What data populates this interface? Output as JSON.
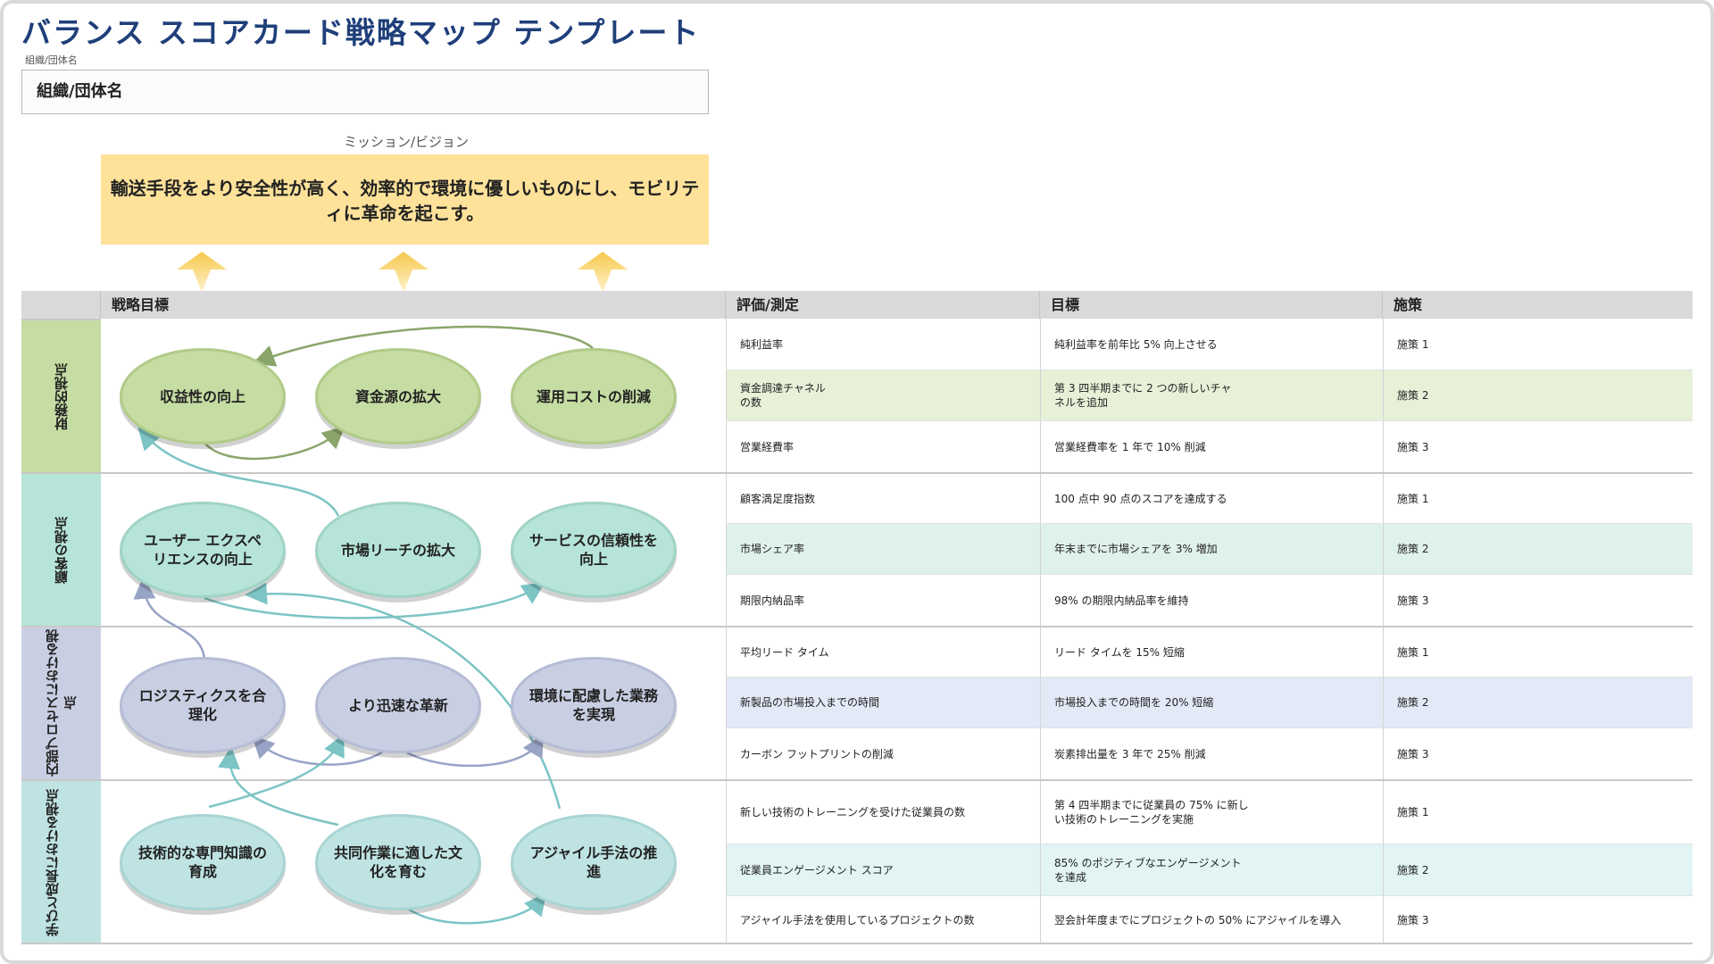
{
  "title": "バランス スコアカード戦略マップ テンプレート",
  "org": {
    "label": "組織/団体名",
    "value": "組織/団体名"
  },
  "mission": {
    "label": "ミッション/ビジョン",
    "text": "輸送手段をより安全性が高く、効率的で環境に優しいものにし、モビリティに革命を起こす。"
  },
  "table": {
    "headers": {
      "perspective": "",
      "objectives": "戦略目標",
      "measure": "評価/測定",
      "target": "目標",
      "initiative": "施策"
    }
  },
  "colors": {
    "financial": "#c5dca2",
    "customer": "#b6e4d8",
    "internal": "#c9cfe3",
    "learning": "#bfe3e3",
    "mission": "#ffe29a",
    "title": "#1f3f7a"
  },
  "perspectives": [
    {
      "name": "財務的視点",
      "objectives": [
        "収益性の向上",
        "資金源の拡大",
        "運用コストの削減"
      ],
      "rows": [
        {
          "measure": "純利益率",
          "target": "純利益率を前年比 5% 向上させる",
          "initiative": "施策 1"
        },
        {
          "measure": "資金調達チャネルの数",
          "target": "第 3 四半期までに 2 つの新しいチャネルを追加",
          "initiative": "施策 2"
        },
        {
          "measure": "営業経費率",
          "target": "営業経費率を 1 年で 10% 削減",
          "initiative": "施策 3"
        }
      ]
    },
    {
      "name": "顧客の視点",
      "objectives": [
        "ユーザー エクスペリエンスの向上",
        "市場リーチの拡大",
        "サービスの信頼性を向上"
      ],
      "rows": [
        {
          "measure": "顧客満足度指数",
          "target": "100 点中 90 点のスコアを達成する",
          "initiative": "施策 1"
        },
        {
          "measure": "市場シェア率",
          "target": "年末までに市場シェアを 3% 増加",
          "initiative": "施策 2"
        },
        {
          "measure": "期限内納品率",
          "target": "98% の期限内納品率を維持",
          "initiative": "施策 3"
        }
      ]
    },
    {
      "name": "内部プロセスにおける視点",
      "objectives": [
        "ロジスティクスを合理化",
        "より迅速な革新",
        "環境に配慮した業務を実現"
      ],
      "rows": [
        {
          "measure": "平均リード タイム",
          "target": "リード タイムを 15% 短縮",
          "initiative": "施策 1"
        },
        {
          "measure": "新製品の市場投入までの時間",
          "target": "市場投入までの時間を 20% 短縮",
          "initiative": "施策 2"
        },
        {
          "measure": "カーボン フットプリントの削減",
          "target": "炭素排出量を 3 年で 25% 削減",
          "initiative": "施策 3"
        }
      ]
    },
    {
      "name": "学びと成長における視点",
      "objectives": [
        "技術的な専門知識の育成",
        "共同作業に適した文化を育む",
        "アジャイル手法の推進"
      ],
      "rows": [
        {
          "measure": "新しい技術のトレーニングを受けた従業員の数",
          "target": "第 4 四半期までに従業員の 75% に新しい技術のトレーニングを実施",
          "initiative": "施策 1"
        },
        {
          "measure": "従業員エンゲージメント スコア",
          "target": "85% のポジティブなエンゲージメントを達成",
          "initiative": "施策 2"
        },
        {
          "measure": "アジャイル手法を使用しているプロジェクトの数",
          "target": "翌会計年度までにプロジェクトの 50% にアジャイルを導入",
          "initiative": "施策 3"
        }
      ]
    }
  ]
}
